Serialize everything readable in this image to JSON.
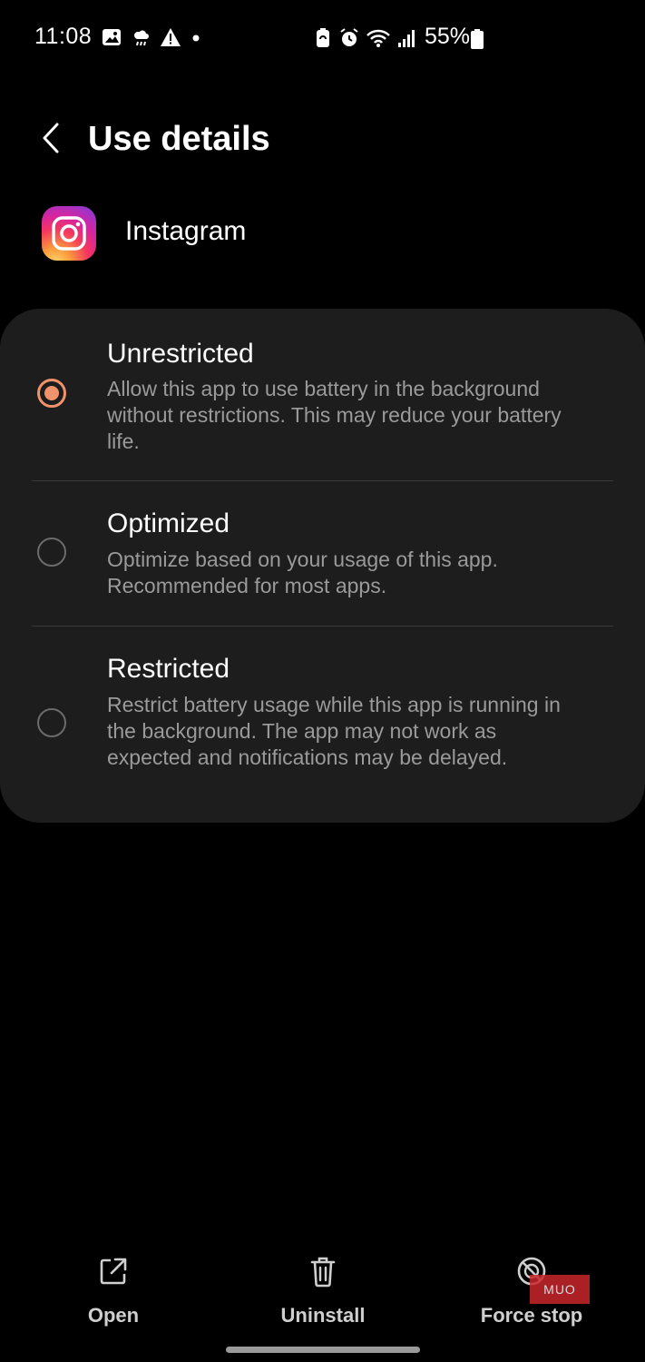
{
  "status_bar": {
    "time": "11:08",
    "battery_text": "55%",
    "left_icons": [
      "gallery-icon",
      "weather-icon",
      "warning-icon",
      "dot-icon"
    ],
    "right_icons": [
      "battery-saver-icon",
      "alarm-icon",
      "wifi-icon",
      "signal-icon",
      "battery-icon"
    ]
  },
  "header": {
    "title": "Use details",
    "back_icon": "back-chevron-icon"
  },
  "app": {
    "name": "Instagram",
    "icon": "instagram-icon"
  },
  "options": [
    {
      "title": "Unrestricted",
      "description": "Allow this app to use battery in the background without restrictions. This may reduce your battery life.",
      "selected": true
    },
    {
      "title": "Optimized",
      "description": "Optimize based on your usage of this app. Recommended for most apps.",
      "selected": false
    },
    {
      "title": "Restricted",
      "description": "Restrict battery usage while this app is running in the background. The app may not work as expected and notifications may be delayed.",
      "selected": false
    }
  ],
  "bottom_bar": {
    "open_label": "Open",
    "uninstall_label": "Uninstall",
    "force_stop_label": "Force stop"
  },
  "watermark": "MUO",
  "colors": {
    "accent": "#f0936a",
    "card": "#1d1d1d",
    "background": "#000000",
    "secondary_text": "#9a9a9a"
  }
}
